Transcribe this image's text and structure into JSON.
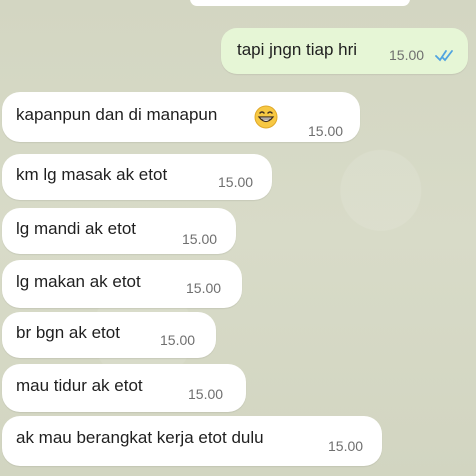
{
  "messages": [
    {
      "text": "tapi jngn tiap hri",
      "time": "15.00",
      "direction": "outgoing",
      "status": "read"
    },
    {
      "text": "kapanpun dan di manapun",
      "time": "15.00",
      "direction": "incoming",
      "emoji": "grinning-face"
    },
    {
      "text": "km lg masak ak etot",
      "time": "15.00",
      "direction": "incoming"
    },
    {
      "text": "lg mandi ak etot",
      "time": "15.00",
      "direction": "incoming"
    },
    {
      "text": "lg makan ak etot",
      "time": "15.00",
      "direction": "incoming"
    },
    {
      "text": "br bgn ak etot",
      "time": "15.00",
      "direction": "incoming"
    },
    {
      "text": "mau tidur ak etot",
      "time": "15.00",
      "direction": "incoming"
    },
    {
      "text": "ak mau berangkat kerja etot dulu",
      "time": "15.00",
      "direction": "incoming"
    }
  ],
  "colors": {
    "background": "#d6d9c6",
    "incoming_bubble": "#ffffff",
    "outgoing_bubble": "#e6f6d6",
    "read_ticks": "#4fa3e0",
    "timestamp": "#6f6f6f"
  }
}
